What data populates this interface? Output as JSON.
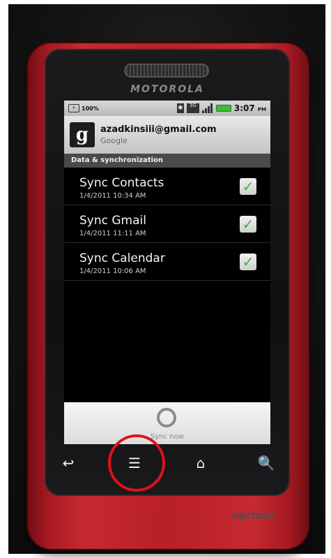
{
  "brand": {
    "name": "MOTOROLA",
    "carrier": "verizon"
  },
  "status_bar": {
    "battery_percent": "100%",
    "network": "3G",
    "time": "3:07",
    "time_suffix": "PM"
  },
  "account": {
    "email": "azadkinsiii@gmail.com",
    "provider": "Google",
    "logo_letter": "g"
  },
  "section": {
    "title": "Data & synchronization"
  },
  "sync_items": [
    {
      "label": "Sync Contacts",
      "timestamp": "1/4/2011 10:34 AM",
      "checked": true
    },
    {
      "label": "Sync Gmail",
      "timestamp": "1/4/2011 11:11 AM",
      "checked": true
    },
    {
      "label": "Sync Calendar",
      "timestamp": "1/4/2011 10:06 AM",
      "checked": true
    }
  ],
  "sync_now": {
    "label": "Sync now"
  },
  "nav": {
    "back_icon": "↩",
    "menu_icon": "☰",
    "home_icon": "⌂",
    "search_icon": "🔍"
  },
  "colors": {
    "case": "#c52a30",
    "highlight": "#e01119",
    "checkmark": "#3bb53a"
  }
}
